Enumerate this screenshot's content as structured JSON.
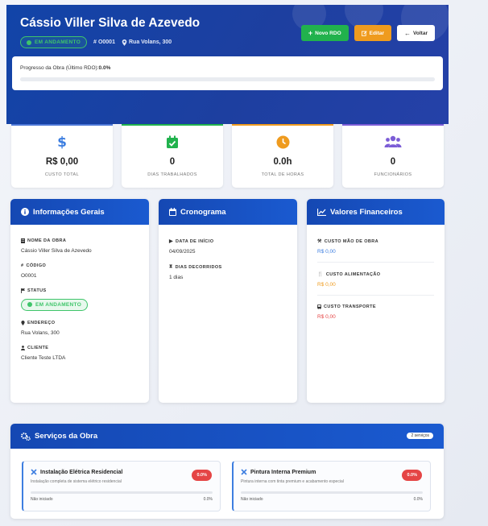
{
  "header": {
    "title": "Cássio Viller Silva de Azevedo",
    "status": "EM ANDAMENTO",
    "code": "O0001",
    "address": "Rua Volans, 300",
    "buttons": {
      "new_rdo": "Novo RDO",
      "edit": "Editar",
      "back": "Voltar"
    },
    "progress_label": "Progresso da Obra (Último RDO):",
    "progress_value": "0.0%",
    "progress_fraction": 0.0
  },
  "stats": [
    {
      "value": "R$ 0,00",
      "label": "CUSTO TOTAL",
      "icon": "dollar-icon",
      "color": "#3d7ee0"
    },
    {
      "value": "0",
      "label": "DIAS TRABALHADOS",
      "icon": "calendar-check-icon",
      "color": "#21b24d"
    },
    {
      "value": "0.0h",
      "label": "TOTAL DE HORAS",
      "icon": "clock-icon",
      "color": "#ef9b1e"
    },
    {
      "value": "0",
      "label": "FUNCIONÁRIOS",
      "icon": "users-icon",
      "color": "#7b5cd6"
    }
  ],
  "info": {
    "title": "Informações Gerais",
    "fields": {
      "name_label": "NOME DA OBRA",
      "name_value": "Cássio Viller Silva de Azevedo",
      "code_label": "CÓDIGO",
      "code_value": "O0001",
      "status_label": "STATUS",
      "status_value": "EM ANDAMENTO",
      "address_label": "ENDEREÇO",
      "address_value": "Rua Volans, 300",
      "client_label": "CLIENTE",
      "client_value": "Cliente Teste LTDA"
    }
  },
  "schedule": {
    "title": "Cronograma",
    "start_label": "DATA DE INÍCIO",
    "start_value": "04/09/2025",
    "elapsed_label": "DIAS DECORRIDOS",
    "elapsed_value": "1 dias"
  },
  "finance": {
    "title": "Valores Financeiros",
    "labor_label": "CUSTO MÃO DE OBRA",
    "labor_value": "R$ 0,00",
    "food_label": "CUSTO ALIMENTAÇÃO",
    "food_value": "R$ 0,00",
    "transport_label": "CUSTO TRANSPORTE",
    "transport_value": "R$ 0,00"
  },
  "services": {
    "title": "Serviços da Obra",
    "count": "2 serviços",
    "items": [
      {
        "name": "Instalação Elétrica Residencial",
        "description": "Instalação completa de sistema elétrico residencial",
        "pct": "0.0%",
        "status": "Não iniciado",
        "progress": "0.0%"
      },
      {
        "name": "Pintura Interna Premium",
        "description": "Pintura interna com tinta premium e acabamento especial",
        "pct": "0.0%",
        "status": "Não iniciado",
        "progress": "0.0%"
      }
    ]
  }
}
